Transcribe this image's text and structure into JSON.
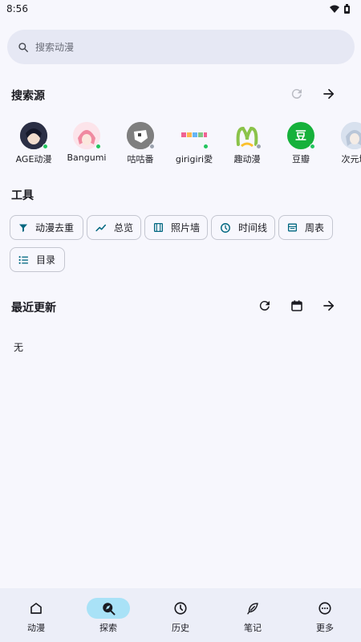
{
  "status": {
    "time": "8:56"
  },
  "search": {
    "placeholder": "搜索动漫"
  },
  "sources_section": {
    "title": "搜索源"
  },
  "sources": [
    {
      "label": "AGE动漫",
      "dot": "#22c55e"
    },
    {
      "label": "Bangumi",
      "dot": "#22c55e"
    },
    {
      "label": "咕咕番",
      "dot": "#9ca3af"
    },
    {
      "label": "girigiri愛",
      "dot": "#22c55e"
    },
    {
      "label": "趣动漫",
      "dot": "#9ca3af"
    },
    {
      "label": "豆瓣",
      "avatar_text": "豆",
      "dot": "#22c55e"
    },
    {
      "label": "次元城",
      "dot": "#22c55e"
    }
  ],
  "tools_section": {
    "title": "工具"
  },
  "tools": [
    {
      "label": "动漫去重",
      "icon": "filter-icon"
    },
    {
      "label": "总览",
      "icon": "trend-icon"
    },
    {
      "label": "照片墙",
      "icon": "film-icon"
    },
    {
      "label": "时间线",
      "icon": "clock-icon"
    },
    {
      "label": "周表",
      "icon": "calendar-table-icon"
    },
    {
      "label": "目录",
      "icon": "list-icon"
    }
  ],
  "recent_section": {
    "title": "最近更新",
    "empty_text": "无"
  },
  "nav": [
    {
      "label": "动漫",
      "icon": "home-icon",
      "active": false
    },
    {
      "label": "探索",
      "icon": "explore-icon",
      "active": true
    },
    {
      "label": "历史",
      "icon": "history-icon",
      "active": false
    },
    {
      "label": "笔记",
      "icon": "feather-icon",
      "active": false
    },
    {
      "label": "更多",
      "icon": "more-icon",
      "active": false
    }
  ],
  "colors": {
    "accent": "#006780",
    "nav_active": "#a9e2f7",
    "background": "#f7f7fd"
  }
}
